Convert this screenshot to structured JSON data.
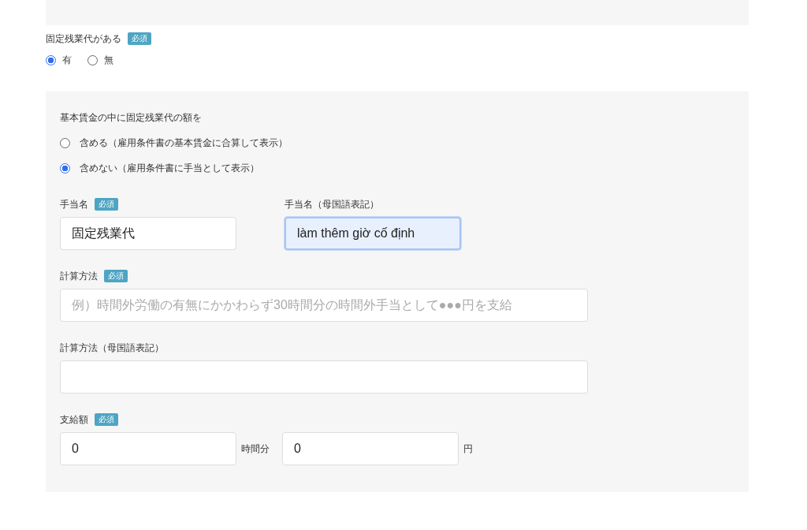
{
  "overtime_question": {
    "label": "固定残業代がある",
    "badge": "必須",
    "options": [
      {
        "label": "有",
        "selected": true
      },
      {
        "label": "無",
        "selected": false
      }
    ]
  },
  "detail_panel": {
    "question": "基本賃金の中に固定残業代の額を",
    "options": [
      {
        "label": "含める（雇用条件書の基本賃金に合算して表示）",
        "selected": false
      },
      {
        "label": "含めない（雇用条件書に手当として表示）",
        "selected": true
      }
    ],
    "fields": [
      {
        "kind": "pair",
        "items": [
          {
            "label": "手当名",
            "badge": "必須",
            "value": "固定残業代",
            "focused": false
          },
          {
            "label": "手当名（母国語表記）",
            "value": "làm thêm giờ cố định",
            "focused": true
          }
        ]
      },
      {
        "kind": "wide",
        "label": "計算方法",
        "badge": "必須",
        "placeholder": "例）時間外労働の有無にかかわらず30時間分の時間外手当として●●●円を支給",
        "focused": false
      },
      {
        "kind": "wide",
        "label": "計算方法（母国語表記）",
        "focused": false
      },
      {
        "kind": "amount",
        "label": "支給額",
        "badge": "必須",
        "inputs": [
          {
            "value": "0",
            "unit": "時間分",
            "focused": false
          },
          {
            "value": "0",
            "unit": "円",
            "focused": false
          }
        ]
      }
    ]
  }
}
